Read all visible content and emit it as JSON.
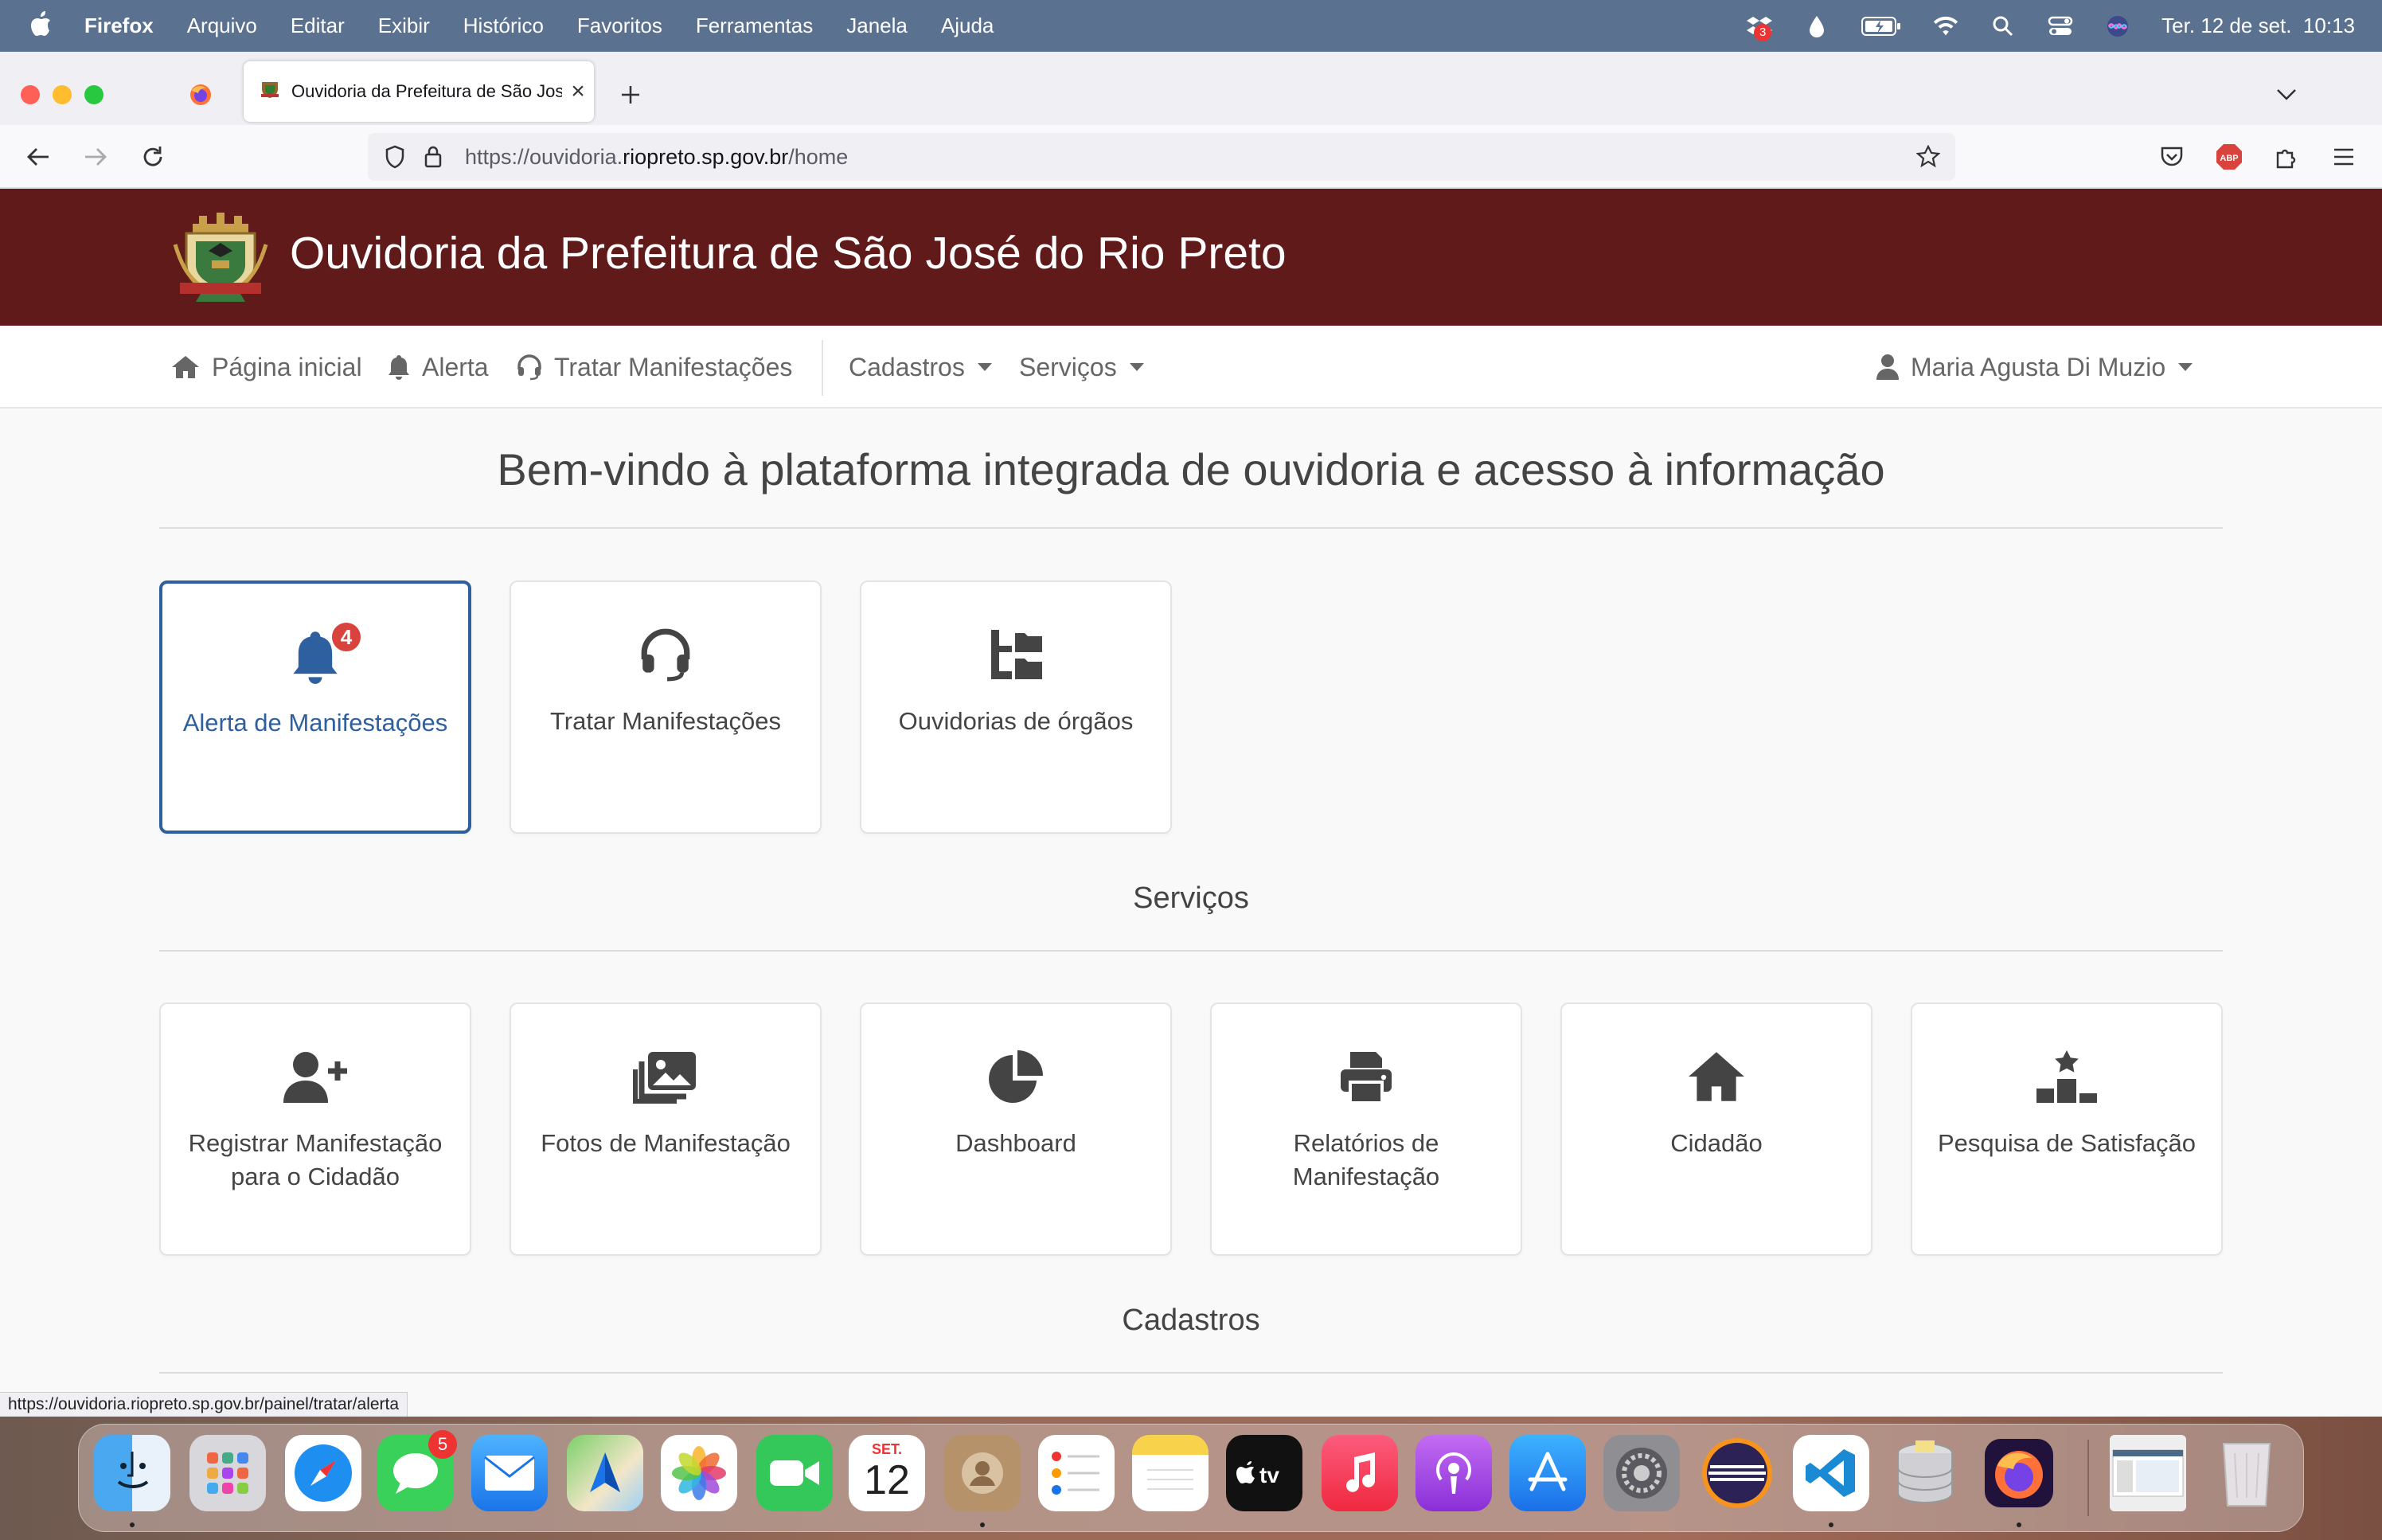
{
  "menubar": {
    "app": "Firefox",
    "items": [
      "Arquivo",
      "Editar",
      "Exibir",
      "Histórico",
      "Favoritos",
      "Ferramentas",
      "Janela",
      "Ajuda"
    ],
    "datetime": "Ter. 12 de set.  10:13",
    "dropbox_badge": "3"
  },
  "browser": {
    "tab_title": "Ouvidoria da Prefeitura de São José do Rio Preto",
    "url_prefix": "https://ouvidoria.",
    "url_domain": "riopreto.sp.gov.br",
    "url_path": "/home",
    "status_link": "https://ouvidoria.riopreto.sp.gov.br/painel/tratar/alerta"
  },
  "banner": {
    "title": "Ouvidoria da Prefeitura de São José do Rio Preto"
  },
  "nav": {
    "home": "Página inicial",
    "alert": "Alerta",
    "treat": "Tratar Manifestações",
    "registries": "Cadastros",
    "services": "Serviços",
    "user": "Maria Agusta Di Muzio"
  },
  "main": {
    "welcome": "Bem-vindo à plataforma integrada de ouvidoria e acesso à informação",
    "top_cards": [
      {
        "label": "Alerta de Manifestações",
        "icon": "bell-icon",
        "badge": "4"
      },
      {
        "label": "Tratar Manifestações",
        "icon": "headset-icon"
      },
      {
        "label": "Ouvidorias de órgãos",
        "icon": "folder-tree-icon"
      }
    ],
    "services_heading": "Serviços",
    "service_cards": [
      {
        "label": "Registrar Manifestação para o Cidadão",
        "icon": "user-plus-icon"
      },
      {
        "label": "Fotos de Manifestação",
        "icon": "photos-icon"
      },
      {
        "label": "Dashboard",
        "icon": "pie-chart-icon"
      },
      {
        "label": "Relatórios de Manifestação",
        "icon": "print-icon"
      },
      {
        "label": "Cidadão",
        "icon": "home-icon"
      },
      {
        "label": "Pesquisa de Satisfação",
        "icon": "ranking-icon"
      }
    ],
    "registries_heading": "Cadastros"
  },
  "dock": {
    "calendar_month": "SET.",
    "calendar_day": "12",
    "messages_badge": "5"
  },
  "colors": {
    "banner": "#601a1a",
    "accent": "#2e5f9e",
    "badge": "#d9433e"
  }
}
